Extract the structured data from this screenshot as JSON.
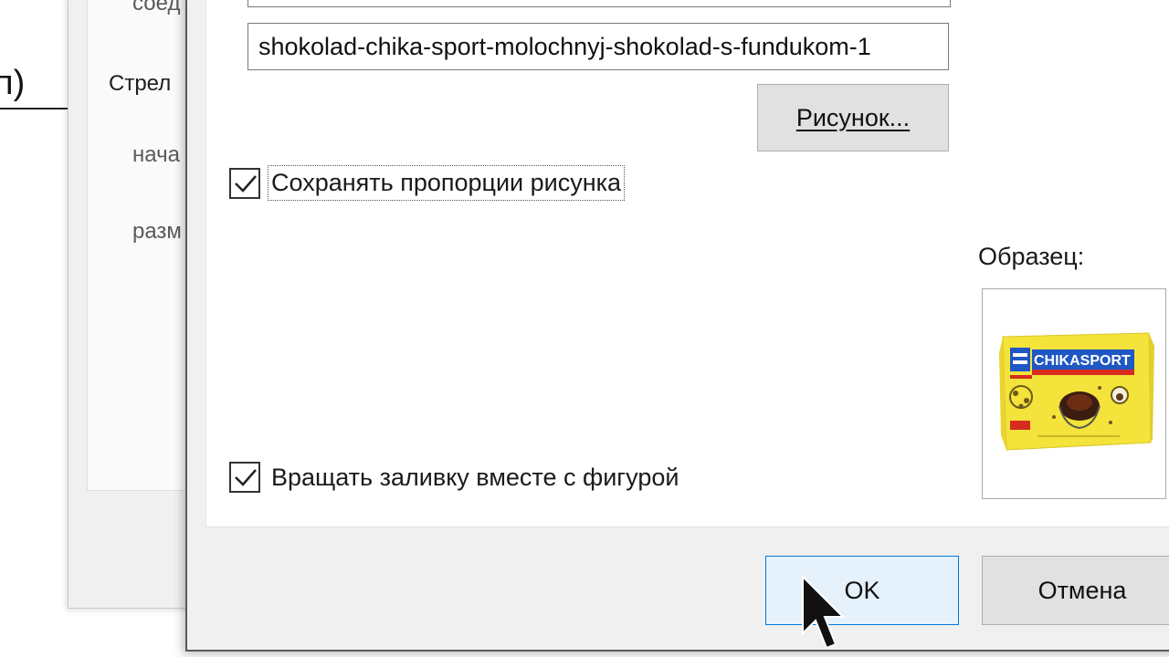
{
  "background_document": {
    "heading_fragment": "п)"
  },
  "background_dialog": {
    "line_1": "соед",
    "line_2": "Стрел",
    "line_3": "нача",
    "line_4": "разм"
  },
  "picture_fill": {
    "file_name": "shokolad-chika-sport-molochnyj-shokolad-s-fundukom-1",
    "picture_button": "Рисунок...",
    "keep_proportions_label": "Сохранять пропорции рисунка",
    "keep_proportions_checked": true,
    "rotate_with_shape_label": "Вращать заливку вместе с фигурой",
    "rotate_with_shape_checked": true
  },
  "sample": {
    "label": "Образец:",
    "brand_text": "CHIKASPORT"
  },
  "footer": {
    "ok_label": "OK",
    "cancel_label": "Отмена"
  },
  "colors": {
    "dialog_bg": "#f0f0f0",
    "ok_accent": "#0078d7",
    "package_yellow": "#f3e33a",
    "package_blue": "#1f57c4",
    "package_red": "#d62b1e"
  }
}
